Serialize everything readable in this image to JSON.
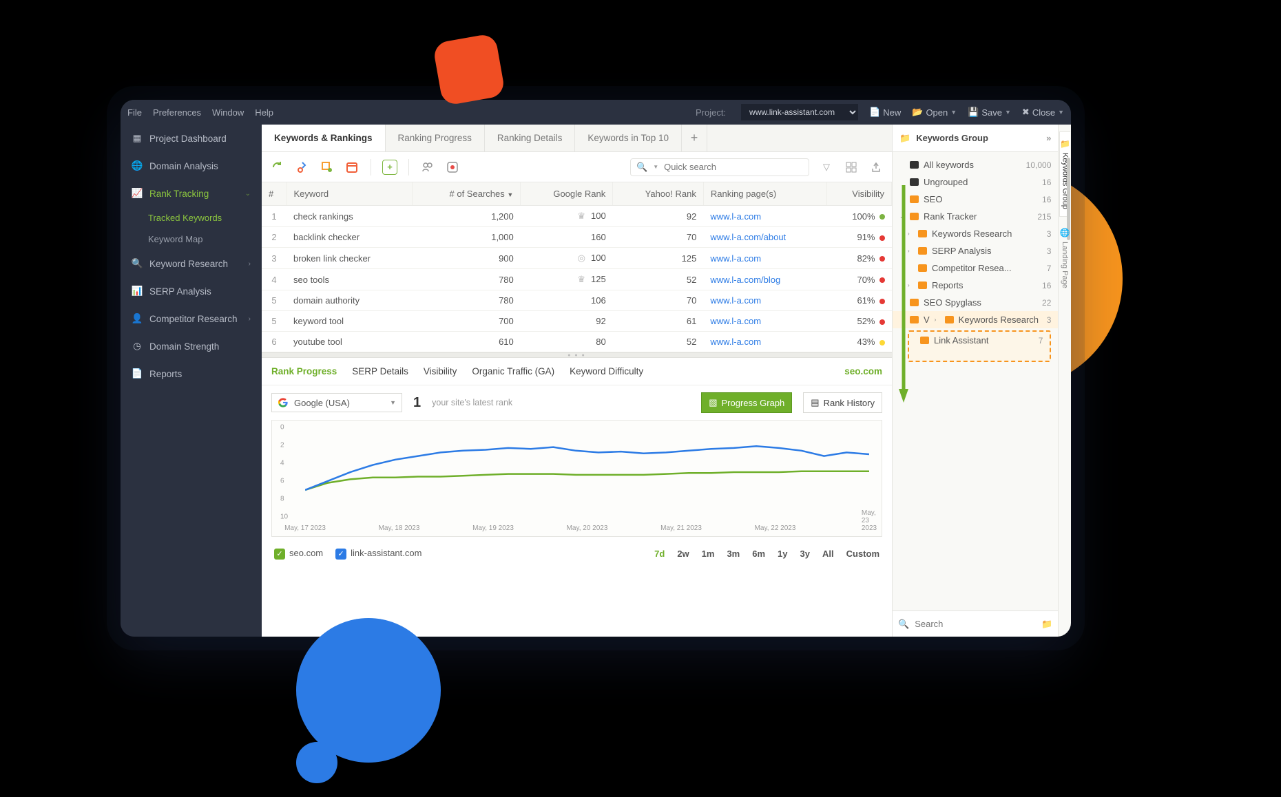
{
  "menubar": {
    "items": [
      "File",
      "Preferences",
      "Window",
      "Help"
    ],
    "project_label": "Project:",
    "project_value": "www.link-assistant.com",
    "buttons": {
      "new": "New",
      "open": "Open",
      "save": "Save",
      "close": "Close"
    }
  },
  "sidebar": {
    "items": [
      {
        "label": "Project Dashboard",
        "icon": "dashboard-icon"
      },
      {
        "label": "Domain Analysis",
        "icon": "globe-icon"
      },
      {
        "label": "Rank Tracking",
        "icon": "chart-line-icon",
        "active": true,
        "expanded": true,
        "children": [
          {
            "label": "Tracked Keywords",
            "active": true
          },
          {
            "label": "Keyword Map"
          }
        ]
      },
      {
        "label": "Keyword Research",
        "icon": "search-icon",
        "chevron": true
      },
      {
        "label": "SERP Analysis",
        "icon": "bars-icon"
      },
      {
        "label": "Competitor Research",
        "icon": "person-icon",
        "chevron": true
      },
      {
        "label": "Domain Strength",
        "icon": "gauge-icon"
      },
      {
        "label": "Reports",
        "icon": "document-icon"
      }
    ]
  },
  "tabs": [
    "Keywords & Rankings",
    "Ranking Progress",
    "Ranking Details",
    "Keywords in Top 10"
  ],
  "tabs_active": 0,
  "search": {
    "placeholder": "Quick search"
  },
  "table": {
    "columns": [
      "#",
      "Keyword",
      "# of Searches",
      "Google Rank",
      "Yahoo! Rank",
      "Ranking page(s)",
      "Visibility"
    ],
    "rows": [
      {
        "n": 1,
        "kw": "check rankings",
        "searches": "1,200",
        "g_icon": "crown",
        "g": 100,
        "y": 92,
        "page": "www.l-a.com",
        "vis": "100%",
        "dot": "g"
      },
      {
        "n": 2,
        "kw": "backlink checker",
        "searches": "1,000",
        "g_icon": "",
        "g": 160,
        "y": 70,
        "page": "www.l-a.com/about",
        "vis": "91%",
        "dot": "r"
      },
      {
        "n": 3,
        "kw": "broken link checker",
        "searches": "900",
        "g_icon": "disc",
        "g": 100,
        "y": 125,
        "page": "www.l-a.com",
        "vis": "82%",
        "dot": "r"
      },
      {
        "n": 4,
        "kw": "seo tools",
        "searches": "780",
        "g_icon": "crown",
        "g": 125,
        "y": 52,
        "page": "www.l-a.com/blog",
        "vis": "70%",
        "dot": "r"
      },
      {
        "n": 5,
        "kw": "domain authority",
        "searches": "780",
        "g_icon": "",
        "g": 106,
        "y": 70,
        "page": "www.l-a.com",
        "vis": "61%",
        "dot": "r"
      },
      {
        "n": 5,
        "kw": "keyword tool",
        "searches": "700",
        "g_icon": "",
        "g": 92,
        "y": 61,
        "page": "www.l-a.com",
        "vis": "52%",
        "dot": "r"
      },
      {
        "n": 6,
        "kw": "youtube tool",
        "searches": "610",
        "g_icon": "",
        "g": 80,
        "y": 52,
        "page": "www.l-a.com",
        "vis": "43%",
        "dot": "y"
      }
    ]
  },
  "subtabs": {
    "items": [
      "Rank Progress",
      "SERP Details",
      "Visibility",
      "Organic Traffic (GA)",
      "Keyword Difficulty"
    ],
    "active": 0,
    "right": "seo.com"
  },
  "chartbar": {
    "engine": "Google (USA)",
    "rank": "1",
    "rank_label": "your site's latest rank",
    "primary_btn": "Progress Graph",
    "secondary_btn": "Rank History"
  },
  "chart_data": {
    "type": "line",
    "title": "",
    "xlabel": "",
    "ylabel": "",
    "ylim": [
      0,
      10
    ],
    "y_inverted": true,
    "y_ticks": [
      0,
      2,
      4,
      6,
      8,
      10
    ],
    "categories": [
      "May, 17 2023",
      "May, 18 2023",
      "May, 19 2023",
      "May, 20 2023",
      "May, 21 2023",
      "May, 22 2023",
      "May, 23 2023"
    ],
    "series": [
      {
        "name": "seo.com",
        "color": "#6FAF2A",
        "values": [
          7.0,
          6.2,
          5.8,
          5.6,
          5.6,
          5.5,
          5.5,
          5.4,
          5.3,
          5.2,
          5.2,
          5.2,
          5.3,
          5.3,
          5.3,
          5.3,
          5.2,
          5.1,
          5.1,
          5.0,
          5.0,
          5.0,
          4.9,
          4.9,
          4.9,
          4.9
        ]
      },
      {
        "name": "link-assistant.com",
        "color": "#2C7BE5",
        "values": [
          7.0,
          6.0,
          5.0,
          4.2,
          3.6,
          3.2,
          2.8,
          2.6,
          2.5,
          2.3,
          2.4,
          2.2,
          2.6,
          2.8,
          2.7,
          2.9,
          2.8,
          2.6,
          2.4,
          2.3,
          2.1,
          2.3,
          2.6,
          3.2,
          2.8,
          3.0
        ]
      }
    ]
  },
  "legend": {
    "items": [
      {
        "label": "seo.com",
        "color": "#6FAF2A"
      },
      {
        "label": "link-assistant.com",
        "color": "#2C7BE5"
      }
    ],
    "periods": [
      "7d",
      "2w",
      "1m",
      "3m",
      "6m",
      "1y",
      "3y",
      "All",
      "Custom"
    ],
    "active": "7d"
  },
  "rpanel": {
    "title": "Keywords Group",
    "rails": [
      {
        "label": "Keywords Group",
        "icon": "folder-icon",
        "active": true
      },
      {
        "label": "Landing Page",
        "icon": "globe-icon"
      }
    ],
    "nodes": [
      {
        "lvl": 0,
        "icon": "bk",
        "label": "All keywords",
        "count": "10,000"
      },
      {
        "lvl": 0,
        "icon": "bk",
        "label": "Ungrouped",
        "count": "16"
      },
      {
        "lvl": 0,
        "icon": "or",
        "label": "SEO",
        "count": "16"
      },
      {
        "lvl": 0,
        "icon": "or",
        "label": "Rank Tracker",
        "count": "215",
        "caret": "down"
      },
      {
        "lvl": 1,
        "icon": "or",
        "label": "Keywords Research",
        "count": "3",
        "caret": "right"
      },
      {
        "lvl": 1,
        "icon": "or",
        "label": "SERP Analysis",
        "count": "3",
        "caret": "right"
      },
      {
        "lvl": 1,
        "icon": "or",
        "label": "Competitor Resea...",
        "count": "7"
      },
      {
        "lvl": 1,
        "icon": "or",
        "label": "Reports",
        "count": "16",
        "caret": "right"
      },
      {
        "lvl": 0,
        "icon": "or",
        "label": "SEO Spyglass",
        "count": "22"
      },
      {
        "lvl": 0,
        "icon": "or",
        "label": "V",
        "count": "",
        "hl": true,
        "extra_icon": true,
        "extra_label": "Keywords Research",
        "extra_count": "3"
      },
      {
        "lvl": 1,
        "icon": "or",
        "label": "Link Assistant",
        "count": "7",
        "drag": true
      }
    ],
    "search_placeholder": "Search"
  }
}
